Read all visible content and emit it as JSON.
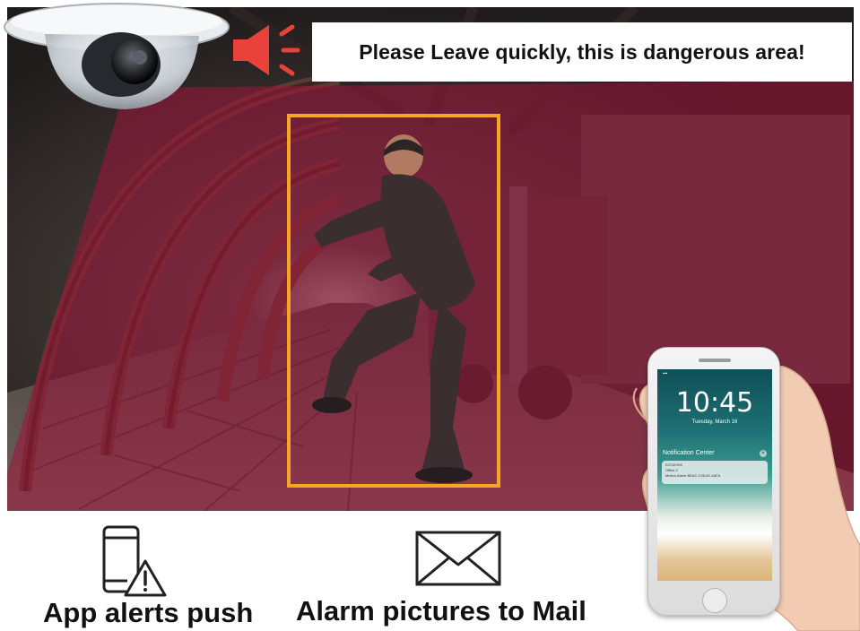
{
  "alert": {
    "message": "Please Leave quickly, this is dangerous area!"
  },
  "features": [
    {
      "label": "App alerts push",
      "icon": "phone-warning-icon"
    },
    {
      "label": "Alarm pictures to Mail",
      "icon": "envelope-icon"
    }
  ],
  "phone": {
    "time": "10:45",
    "date": "Tuesday, March 16",
    "notification_center_label": "Notification Center",
    "notification": {
      "app": "EZVIZ/HIK",
      "title": "Office 2",
      "body": "Motion Alarm  BEAC-C9D4G-4AFA"
    }
  },
  "colors": {
    "detection_box": "#f5a623",
    "zone_overlay": "#a0143c",
    "speaker": "#e8423a",
    "banner_bg": "#ffffff"
  }
}
